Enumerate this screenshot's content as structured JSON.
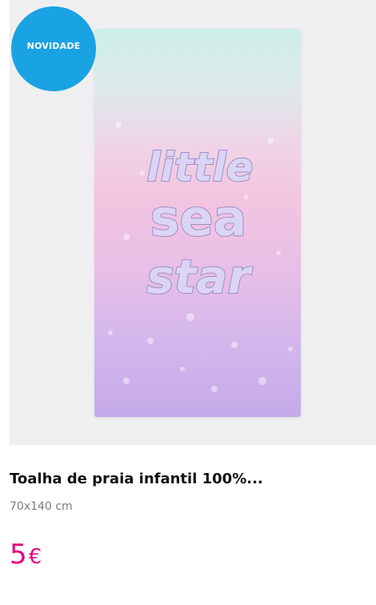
{
  "product": {
    "badge": "NOVIDADE",
    "image_text": [
      "little",
      "sea",
      "star"
    ],
    "title": "Toalha de praia infantil 100%...",
    "size": "70x140 cm",
    "price_value": "5",
    "price_currency": "€"
  },
  "colors": {
    "badge": "#1aa3e3",
    "price": "#e6007e",
    "image_background": "#efeff1"
  }
}
